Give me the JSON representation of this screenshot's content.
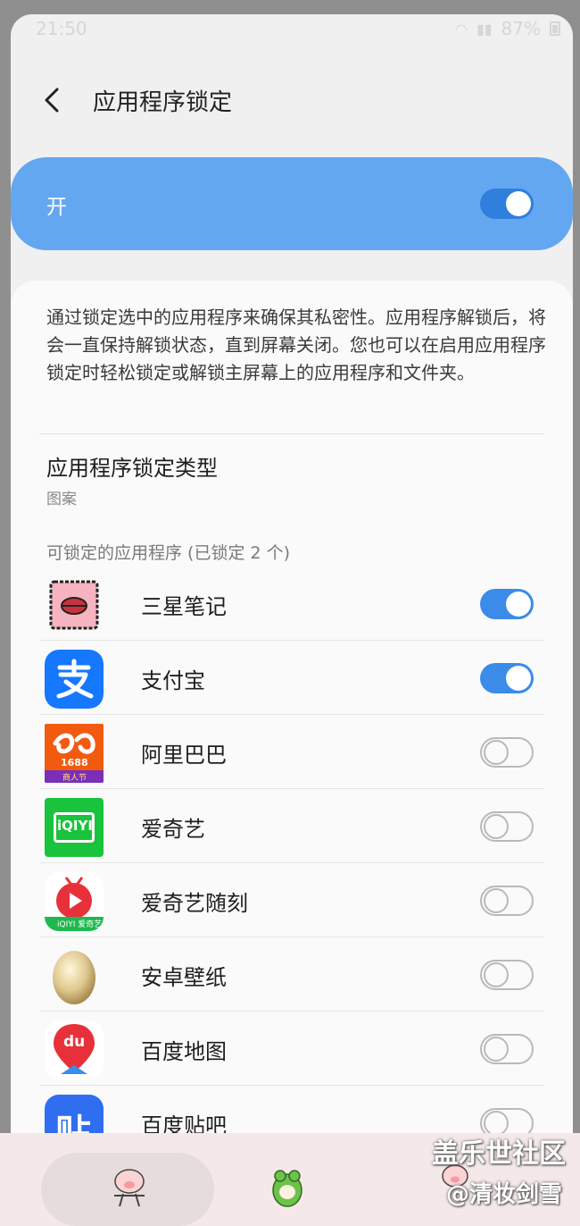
{
  "status": {
    "time": "21:50",
    "battery": "87%"
  },
  "header": {
    "title": "应用程序锁定"
  },
  "master": {
    "label": "开",
    "on": true
  },
  "description": "通过锁定选中的应用程序来确保其私密性。应用程序解锁后，将会一直保持解锁状态，直到屏幕关闭。您也可以在启用应用程序锁定时轻松锁定或解锁主屏幕上的应用程序和文件夹。",
  "lock_type": {
    "title": "应用程序锁定类型",
    "value": "图案"
  },
  "section_header": "可锁定的应用程序 (已锁定 2 个)",
  "apps": [
    {
      "name": "三星笔记",
      "icon": "samsung-notes-icon",
      "locked": true
    },
    {
      "name": "支付宝",
      "icon": "alipay-icon",
      "locked": true
    },
    {
      "name": "阿里巴巴",
      "icon": "alibaba-1688-icon",
      "locked": false,
      "icon_text": "1688",
      "icon_badge": "商人节"
    },
    {
      "name": "爱奇艺",
      "icon": "iqiyi-icon",
      "locked": false,
      "icon_text": "iQIYI"
    },
    {
      "name": "爱奇艺随刻",
      "icon": "iqiyi-suike-icon",
      "locked": false,
      "icon_text": "iQIYI 爱奇艺"
    },
    {
      "name": "安卓壁纸",
      "icon": "android-wallpaper-icon",
      "locked": false
    },
    {
      "name": "百度地图",
      "icon": "baidu-map-icon",
      "locked": false,
      "icon_text": "du"
    },
    {
      "name": "百度贴吧",
      "icon": "baidu-tieba-icon",
      "locked": false,
      "icon_text": "贴"
    }
  ],
  "watermark": {
    "line1": "盖乐世社区",
    "line2": "@清妆剑雪"
  },
  "colors": {
    "accent": "#3b8be8",
    "master_card": "#63a7f1"
  }
}
